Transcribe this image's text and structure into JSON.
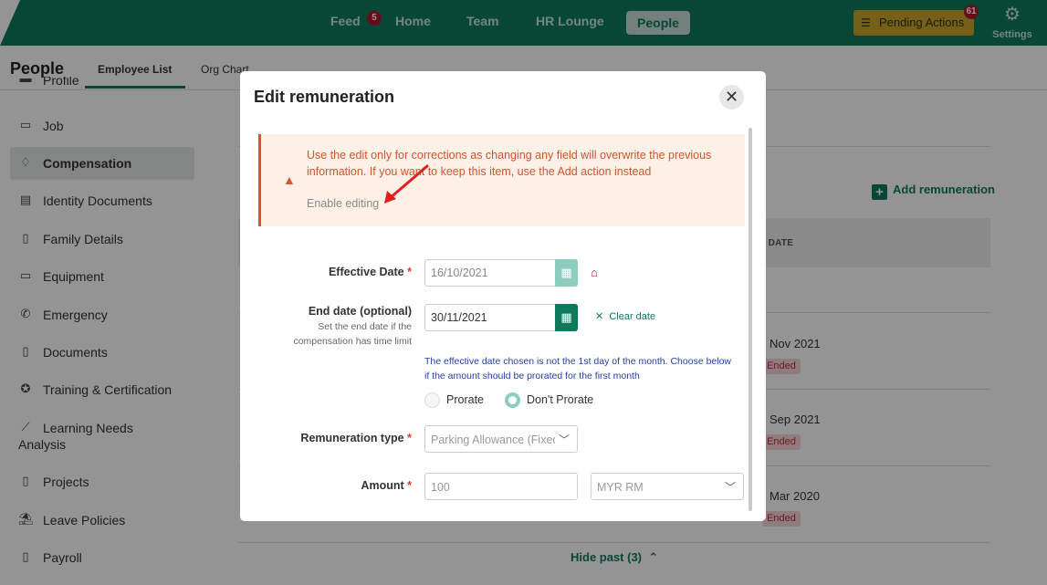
{
  "nav": {
    "feed": "Feed",
    "feed_badge": "5",
    "home": "Home",
    "team": "Team",
    "hr_lounge": "HR Lounge",
    "people": "People",
    "pending_actions": "Pending Actions",
    "pending_badge": "61",
    "settings": "Settings"
  },
  "page": {
    "title": "People",
    "tabs": [
      "Employee List",
      "Org Chart"
    ],
    "active_tab": "Employee List"
  },
  "sidebar": {
    "partial_top": "Profile",
    "items": [
      {
        "label": "Job",
        "icon": "briefcase-icon"
      },
      {
        "label": "Compensation",
        "icon": "money-bag-icon",
        "active": true
      },
      {
        "label": "Identity Documents",
        "icon": "id-card-icon"
      },
      {
        "label": "Family Details",
        "icon": "family-icon"
      },
      {
        "label": "Equipment",
        "icon": "laptop-icon"
      },
      {
        "label": "Emergency",
        "icon": "phone-icon"
      },
      {
        "label": "Documents",
        "icon": "document-icon"
      },
      {
        "label": "Training & Certification",
        "icon": "award-icon"
      },
      {
        "label": "Learning Needs",
        "label2": "Analysis",
        "icon": "chart-icon"
      },
      {
        "label": "Projects",
        "icon": "clipboard-icon"
      },
      {
        "label": "Leave Policies",
        "icon": "leave-icon"
      },
      {
        "label": "Payroll",
        "icon": "payroll-icon"
      }
    ]
  },
  "main": {
    "add_remuneration": "Add remuneration",
    "table_header_col": "D DATE",
    "rows": [
      {
        "date": "Nov 2021",
        "status": "Ended"
      },
      {
        "date": "Sep 2021",
        "status": "Ended"
      },
      {
        "date": "Mar 2020",
        "status": "Ended"
      }
    ],
    "hide_past": "Hide past (3)"
  },
  "modal": {
    "title": "Edit remuneration",
    "warning": "Use the edit only for corrections as changing any field will overwrite the previous information. If you want to keep this item, use the Add action instead",
    "enable_editing": "Enable editing",
    "effective_date_label": "Effective Date",
    "effective_date_value": "16/10/2021",
    "end_date_label": "End date (optional)",
    "end_date_hint": "Set the end date if the compensation has time limit",
    "end_date_value": "30/11/2021",
    "clear_date": "Clear date",
    "proration_info": "The effective date chosen is not the 1st day of the month. Choose below if the amount should be prorated for the first month",
    "prorate": "Prorate",
    "dont_prorate": "Don't Prorate",
    "proration_selected": "Don't Prorate",
    "remuneration_type_label": "Remuneration type",
    "remuneration_type_value": "Parking Allowance (Fixed)",
    "amount_label": "Amount",
    "amount_value": "100",
    "currency_value": "MYR RM",
    "required_mark": "*"
  },
  "colors": {
    "brand": "#0e7a5c",
    "warning": "#d2552d",
    "badge": "#b3152a",
    "pending": "#c9a62a"
  }
}
